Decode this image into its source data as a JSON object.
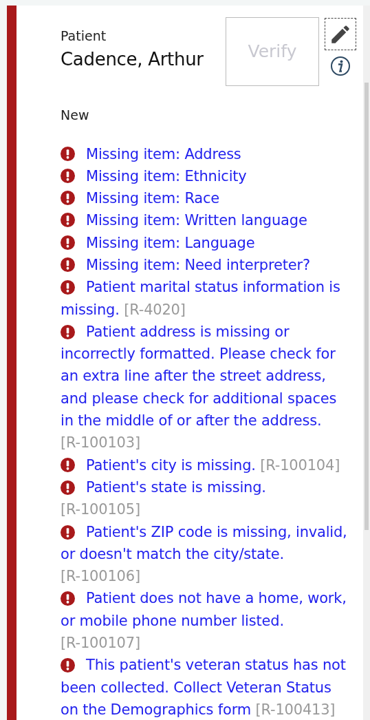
{
  "patient": {
    "label": "Patient",
    "name": "Cadence, Arthur",
    "status": "New"
  },
  "verify_button": {
    "label": "Verify",
    "disabled": true
  },
  "messages": [
    {
      "text": "Missing item: Address"
    },
    {
      "text": "Missing item: Ethnicity"
    },
    {
      "text": "Missing item: Race"
    },
    {
      "text": "Missing item: Written language"
    },
    {
      "text": "Missing item: Language"
    },
    {
      "text": "Missing item: Need interpreter?"
    },
    {
      "text": "Patient marital status information is missing.",
      "code": "[R-4020]"
    },
    {
      "text": "Patient address is missing or incorrectly formatted. Please check for an extra line after the street address, and please check for additional spaces in the middle of or after the address.",
      "code": "[R-100103]"
    },
    {
      "text": "Patient's city is missing.",
      "code": "[R-100104]"
    },
    {
      "text": "Patient's state is missing.",
      "code": "[R-100105]"
    },
    {
      "text": "Patient's ZIP code is missing, invalid, or doesn't match the city/state.",
      "code": "[R-100106]"
    },
    {
      "text": "Patient does not have a home, work, or mobile phone number listed.",
      "code": "[R-100107]"
    },
    {
      "text": "This patient's veteran status has not been collected. Collect Veteran Status on the Demographics form",
      "code": "[R-100413]"
    }
  ]
}
